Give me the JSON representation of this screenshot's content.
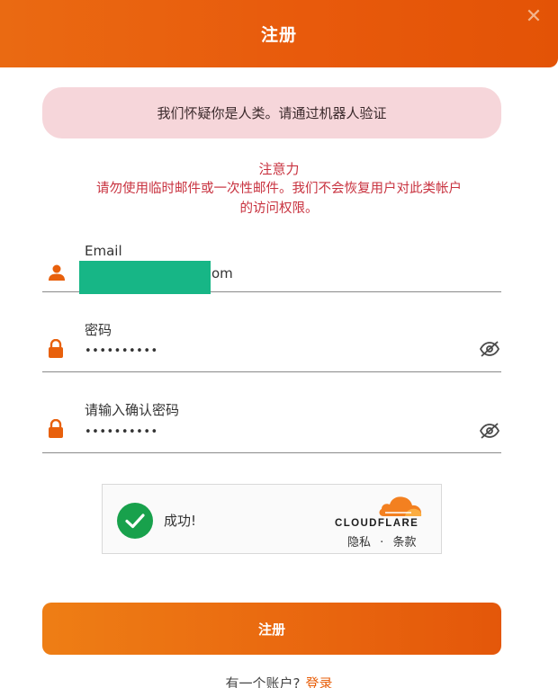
{
  "header": {
    "title": "注册",
    "close_symbol": "✕"
  },
  "alert": {
    "text": "我们怀疑你是人类。请通过机器人验证"
  },
  "notice": {
    "title": "注意力",
    "line1": "请勿使用临时邮件或一次性邮件。我们不会恢复用户对此类帐户",
    "line2": "的访问权限。"
  },
  "form": {
    "email": {
      "label": "Email",
      "value_suffix": "om",
      "icon": "user-icon"
    },
    "password": {
      "label": "密码",
      "value": "••••••••••",
      "icon": "lock-icon",
      "toggle_icon": "eye-off-icon"
    },
    "confirm": {
      "label": "请输入确认密码",
      "value": "••••••••••",
      "icon": "lock-icon",
      "toggle_icon": "eye-off-icon"
    }
  },
  "captcha": {
    "status": "成功!",
    "brand": "CLOUDFLARE",
    "privacy": "隐私",
    "separator": "·",
    "terms": "条款"
  },
  "submit": {
    "label": "注册"
  },
  "footer": {
    "prompt": "有一个账户?",
    "login_label": "登录"
  },
  "colors": {
    "accent": "#e85a0c",
    "alert_bg": "#f6d6da",
    "notice_text": "#c8323f",
    "success": "#18a14c",
    "cloudflare_orange": "#f38020",
    "email_redaction": "#17b686"
  }
}
